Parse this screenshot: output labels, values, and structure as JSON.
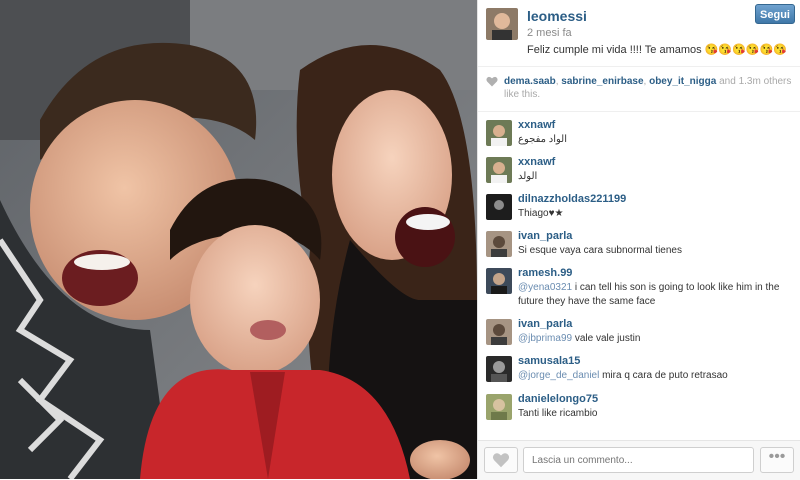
{
  "post": {
    "username": "leomessi",
    "time": "2 mesi fa",
    "caption": "Feliz cumple mi vida !!!! Te amamos 😘😘😘😘😘😘",
    "follow_label": "Segui"
  },
  "likes": {
    "users": [
      "dema.saab",
      "sabrine_enirbase",
      "obey_it_nigga"
    ],
    "rest": "and 1.3m others like this."
  },
  "comments": [
    {
      "user": "xxnawf",
      "mention": "",
      "text": "الواد مفجوع"
    },
    {
      "user": "xxnawf",
      "mention": "",
      "text": "الولد"
    },
    {
      "user": "dilnazzholdas221199",
      "mention": "",
      "text": "Thiago♥★"
    },
    {
      "user": "ivan_parla",
      "mention": "",
      "text": "Si esque vaya cara subnormal tienes"
    },
    {
      "user": "ramesh.99",
      "mention": "@yena0321",
      "text": " i can tell his son is going to look like him in the future they have the same face"
    },
    {
      "user": "ivan_parla",
      "mention": "@jbprima99",
      "text": " vale vale justin"
    },
    {
      "user": "samusala15",
      "mention": "@jorge_de_daniel",
      "text": " mira q cara de puto retrasao"
    },
    {
      "user": "danielelongo75",
      "mention": "",
      "text": "Tanti like ricambio"
    }
  ],
  "comment_box": {
    "placeholder": "Lascia un commento..."
  },
  "icons": {
    "like": "heart-icon",
    "more": "more-dots-icon"
  },
  "colors": {
    "link": "#2c5e86",
    "follow": "#4f8bbf",
    "meta": "#8a8a8a"
  }
}
